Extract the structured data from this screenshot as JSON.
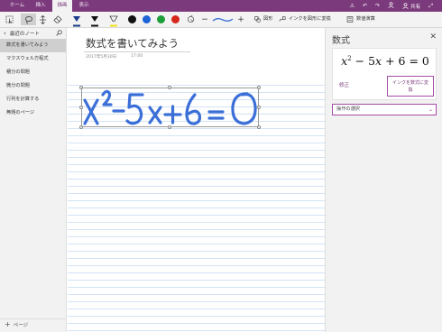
{
  "ribbon": {
    "tabs": [
      {
        "label": "ホーム"
      },
      {
        "label": "挿入"
      },
      {
        "label": "描画"
      },
      {
        "label": "表示"
      }
    ],
    "share_label": "共有"
  },
  "toolbar": {
    "convert_shape_label": "図形",
    "ink_to_shape_label": "インクを図形に変換",
    "math_label": "数値演算",
    "colors": [
      "#111111",
      "#1e63d6",
      "#1e9e3b",
      "#d7271d"
    ],
    "stroke_color": "#3b6fd8"
  },
  "sidebar": {
    "header": "最近のノート",
    "items": [
      {
        "label": "数式を書いてみよう"
      },
      {
        "label": "マクスウェル方程式"
      },
      {
        "label": "積分の問題"
      },
      {
        "label": "微分の問題"
      },
      {
        "label": "行列を計算する"
      },
      {
        "label": "無題のページ"
      }
    ],
    "add_page_label": "ページ"
  },
  "page": {
    "title": "数式を書いてみよう",
    "date": "2017年5月30日",
    "time": "17:00"
  },
  "math_panel": {
    "title": "数式",
    "equation": {
      "x1": "x",
      "exp": "2",
      "minus_term": " − 5",
      "x2": "x",
      "rest": " + 6 = 0"
    },
    "fix_label": "修正",
    "convert_line1": "インクを数式に変",
    "convert_line2": "換",
    "select_placeholder": "操作の選択"
  }
}
